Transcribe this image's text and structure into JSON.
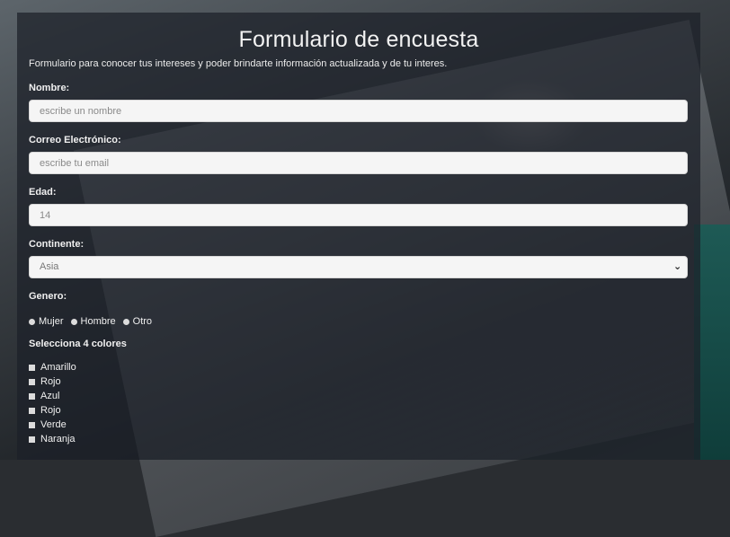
{
  "form": {
    "title": "Formulario de encuesta",
    "description": "Formulario para conocer tus intereses y poder brindarte información actualizada y de tu interes.",
    "name": {
      "label": "Nombre:",
      "placeholder": "escribe un nombre"
    },
    "email": {
      "label": "Correo Electrónico:",
      "placeholder": "escribe tu email"
    },
    "age": {
      "label": "Edad:",
      "placeholder": "14"
    },
    "continent": {
      "label": "Continente:",
      "selected": "Asia"
    },
    "gender": {
      "label": "Genero:",
      "options": [
        "Mujer",
        "Hombre",
        "Otro"
      ]
    },
    "colors": {
      "label": "Selecciona 4 colores",
      "options": [
        "Amarillo",
        "Rojo",
        "Azul",
        "Rojo",
        "Verde",
        "Naranja"
      ]
    }
  },
  "icons": {
    "select_arrow": "chevron-down-icon"
  }
}
